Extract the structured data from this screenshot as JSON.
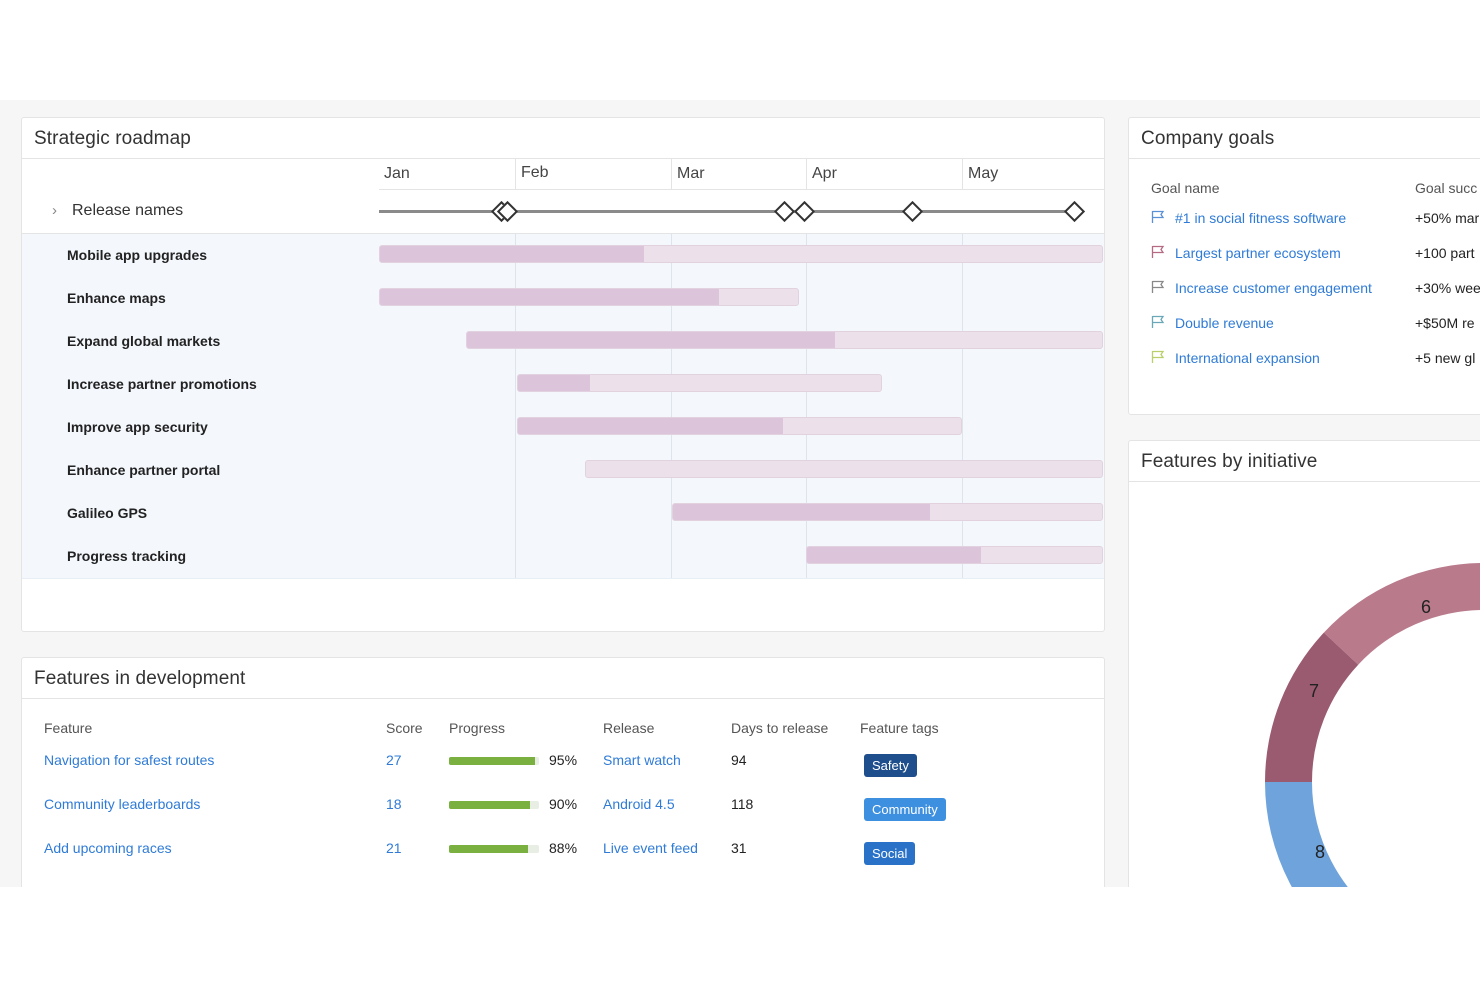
{
  "roadmap": {
    "title": "Strategic roadmap",
    "months": [
      "Jan",
      "Feb",
      "Mar",
      "Apr",
      "May"
    ],
    "release_label": "Release names",
    "initiatives": [
      {
        "name": "Mobile app upgrades",
        "start": 0.0,
        "end": 1.0,
        "progress": 0.365
      },
      {
        "name": "Enhance maps",
        "start": 0.0,
        "end": 0.58,
        "progress": 0.81
      },
      {
        "name": "Expand global markets",
        "start": 0.12,
        "end": 1.0,
        "progress": 0.58
      },
      {
        "name": "Increase partner promotions",
        "start": 0.19,
        "end": 0.695,
        "progress": 0.2
      },
      {
        "name": "Improve app security",
        "start": 0.19,
        "end": 0.805,
        "progress": 0.6
      },
      {
        "name": "Enhance partner portal",
        "start": 0.285,
        "end": 1.0,
        "progress": 0.0
      },
      {
        "name": "Galileo GPS",
        "start": 0.405,
        "end": 1.0,
        "progress": 0.6
      },
      {
        "name": "Progress tracking",
        "start": 0.59,
        "end": 1.0,
        "progress": 0.59
      }
    ]
  },
  "features": {
    "title": "Features in development",
    "headers": {
      "feature": "Feature",
      "score": "Score",
      "progress": "Progress",
      "release": "Release",
      "days": "Days to release",
      "tags": "Feature tags"
    },
    "rows": [
      {
        "feature": "Navigation for safest routes",
        "score": "27",
        "progress": 0.95,
        "progress_label": "95%",
        "release": "Smart watch",
        "days": "94",
        "tag": "Safety"
      },
      {
        "feature": "Community leaderboards",
        "score": "18",
        "progress": 0.9,
        "progress_label": "90%",
        "release": "Android 4.5",
        "days": "118",
        "tag": "Community"
      },
      {
        "feature": "Add upcoming races",
        "score": "21",
        "progress": 0.88,
        "progress_label": "88%",
        "release": "Live event feed",
        "days": "31",
        "tag": "Social"
      }
    ],
    "tag_colors": {
      "Safety": "#1f4e8c",
      "Community": "#3d8fe0",
      "Social": "#2a72c8"
    }
  },
  "goals": {
    "title": "Company goals",
    "headers": {
      "name": "Goal name",
      "success": "Goal succ"
    },
    "items": [
      {
        "name": "#1 in social fitness software",
        "metric": "+50% mar",
        "flag_color": "#5b8fd6"
      },
      {
        "name": "Largest partner ecosystem",
        "metric": "+100 part",
        "flag_color": "#b56a84"
      },
      {
        "name": "Increase customer engagement",
        "metric": "+30% wee",
        "flag_color": "#888888"
      },
      {
        "name": "Double revenue",
        "metric": "+$50M re",
        "flag_color": "#6aa8b8"
      },
      {
        "name": "International expansion",
        "metric": "+5 new gl",
        "flag_color": "#b9cf6a"
      }
    ]
  },
  "initiative": {
    "title": "Features by initiative",
    "slices": [
      {
        "label": "6",
        "color": "#b97a8c"
      },
      {
        "label": "7",
        "color": "#9a5a70"
      },
      {
        "label": "8",
        "color": "#6fa3dc"
      }
    ]
  }
}
